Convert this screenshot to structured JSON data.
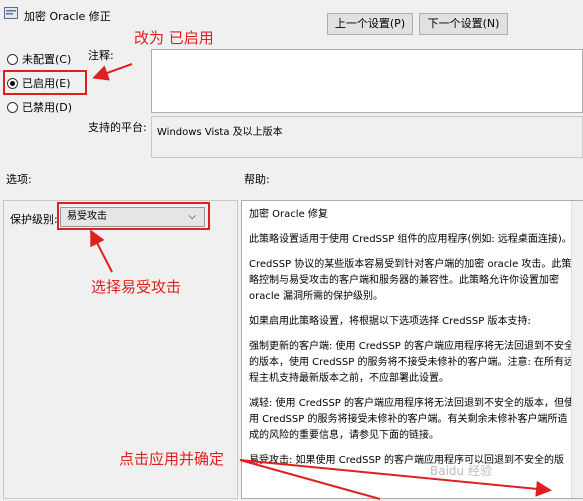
{
  "window": {
    "title": "加密 Oracle 修正"
  },
  "nav": {
    "prev_label": "上一个设置(P)",
    "next_label": "下一个设置(N)"
  },
  "state": {
    "options": [
      {
        "label": "未配置(C)",
        "checked": false
      },
      {
        "label": "已启用(E)",
        "checked": true
      },
      {
        "label": "已禁用(D)",
        "checked": false
      }
    ]
  },
  "fields": {
    "comment_label": "注释:",
    "platform_label": "支持的平台:",
    "platform_value": "Windows Vista 及以上版本",
    "options_label": "选项:",
    "help_label": "帮助:",
    "protection_label": "保护级别:",
    "protection_value": "易受攻击"
  },
  "help": {
    "paragraphs": [
      "加密 Oracle 修复",
      "此策略设置适用于使用 CredSSP 组件的应用程序(例如: 远程桌面连接)。",
      "CredSSP 协议的某些版本容易受到针对客户端的加密 oracle 攻击。此策略控制与易受攻击的客户端和服务器的兼容性。此策略允许你设置加密 oracle 漏洞所需的保护级别。",
      "如果启用此策略设置，将根据以下选项选择 CredSSP 版本支持:",
      "强制更新的客户端: 使用 CredSSP 的客户端应用程序将无法回退到不安全的版本，使用 CredSSP 的服务将不接受未修补的客户端。注意: 在所有远程主机支持最新版本之前，不应部署此设置。",
      "减轻: 使用 CredSSP 的客户端应用程序将无法回退到不安全的版本，但使用 CredSSP 的服务将接受未修补的客户端。有关剩余未修补客户端所造成的风险的重要信息，请参见下面的链接。",
      "易受攻击: 如果使用 CredSSP 的客户端应用程序可以回退到不安全的版"
    ]
  },
  "annotations": {
    "enable": "改为 已启用",
    "select": "选择易受攻击",
    "apply": "点击应用并确定"
  },
  "watermark": "Baidu 经验"
}
